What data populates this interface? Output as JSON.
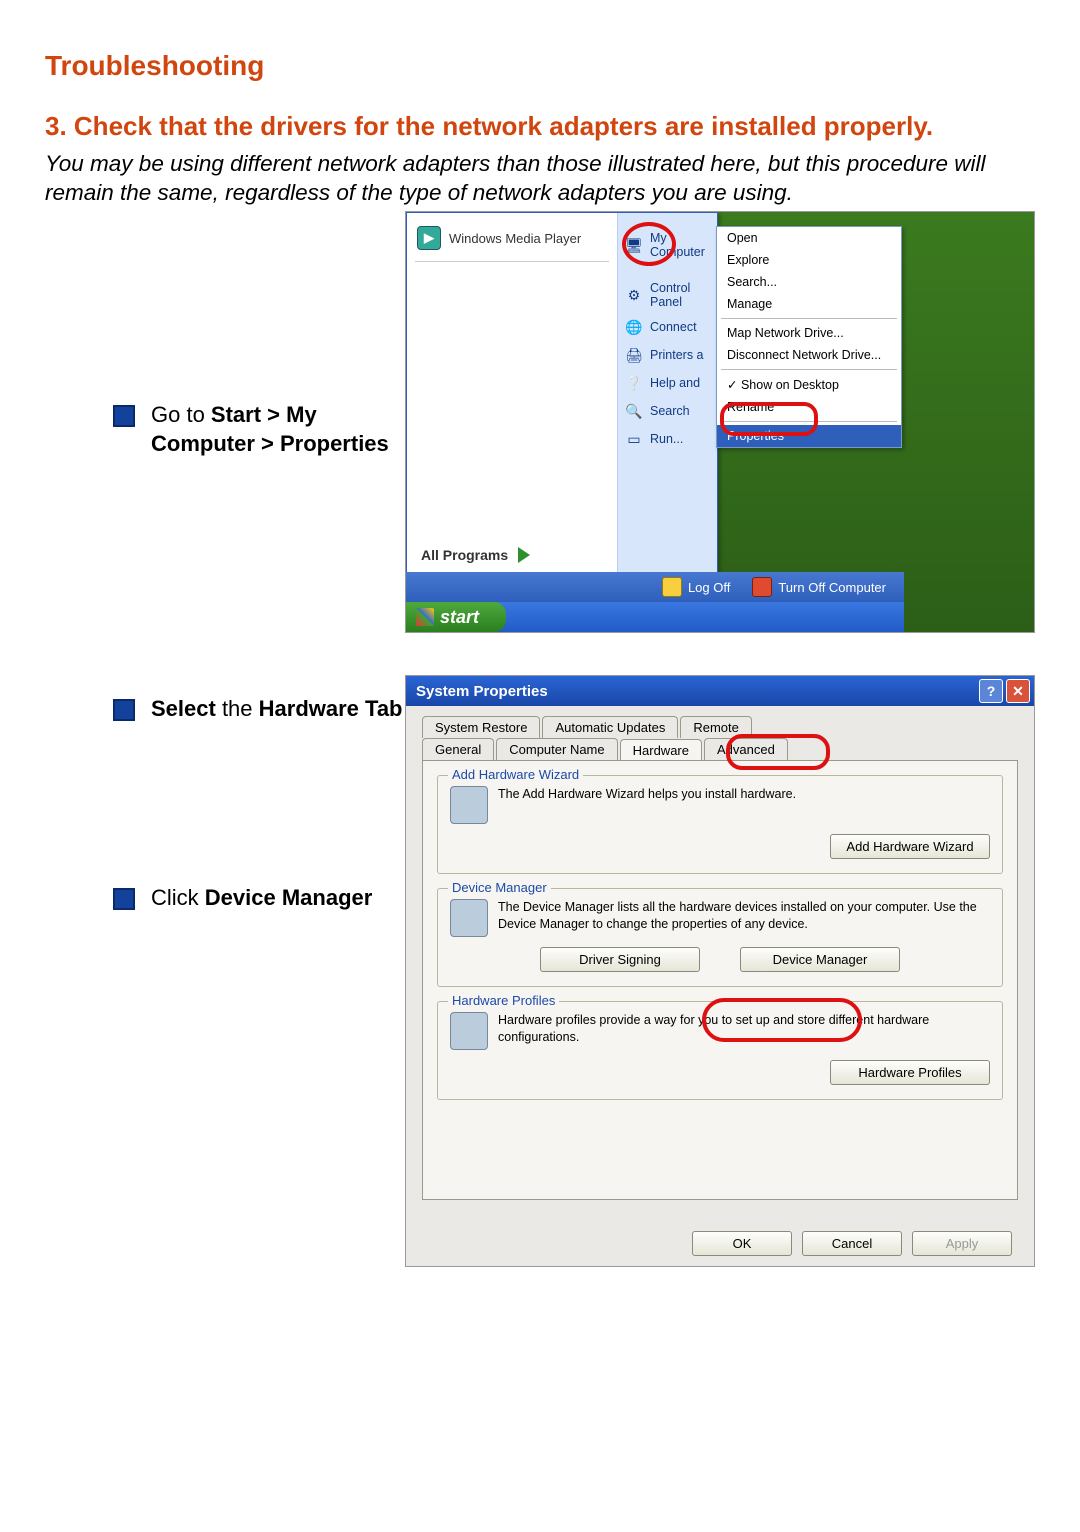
{
  "title": "Troubleshooting",
  "step_heading": "3.  Check that the drivers for the network adapters are installed properly.",
  "intro": "You may be using different network adapters than those illustrated here, but this procedure will remain the same, regardless of the type of network adapters you are using.",
  "bullets": {
    "b1_pre": "Go to ",
    "b1_bold1": "Start > My Computer > Properties",
    "b2_pre": "Select",
    "b2_rest": " the ",
    "b2_bold": "Hardware Tab",
    "b3_pre": "Click ",
    "b3_bold": "Device Manager"
  },
  "startmenu": {
    "left_top": "Windows Media Player",
    "all_programs": "All Programs",
    "right": {
      "my_computer": "My Computer",
      "control_panel": "Control Panel",
      "connect": "Connect",
      "printers": "Printers a",
      "help": "Help and",
      "search": "Search",
      "run": "Run..."
    },
    "logoff": "Log Off",
    "turnoff": "Turn Off Computer",
    "start": "start"
  },
  "context": {
    "open": "Open",
    "explore": "Explore",
    "search": "Search...",
    "manage": "Manage",
    "map": "Map Network Drive...",
    "disconnect": "Disconnect Network Drive...",
    "show": "Show on Desktop",
    "rename": "Rename",
    "properties": "Properties"
  },
  "sysprops": {
    "title": "System Properties",
    "tabs_row1": {
      "restore": "System Restore",
      "updates": "Automatic Updates",
      "remote": "Remote"
    },
    "tabs_row2": {
      "general": "General",
      "name": "Computer Name",
      "hardware": "Hardware",
      "advanced": "Advanced"
    },
    "add_hw": {
      "legend": "Add Hardware Wizard",
      "text": "The Add Hardware Wizard helps you install hardware.",
      "btn": "Add Hardware Wizard"
    },
    "devmgr": {
      "legend": "Device Manager",
      "text": "The Device Manager lists all the hardware devices installed on your computer. Use the Device Manager to change the properties of any device.",
      "btn_sign": "Driver Signing",
      "btn_dm": "Device Manager"
    },
    "hwprof": {
      "legend": "Hardware Profiles",
      "text": "Hardware profiles provide a way for you to set up and store different hardware configurations.",
      "btn": "Hardware Profiles"
    },
    "ok": "OK",
    "cancel": "Cancel",
    "apply": "Apply"
  }
}
